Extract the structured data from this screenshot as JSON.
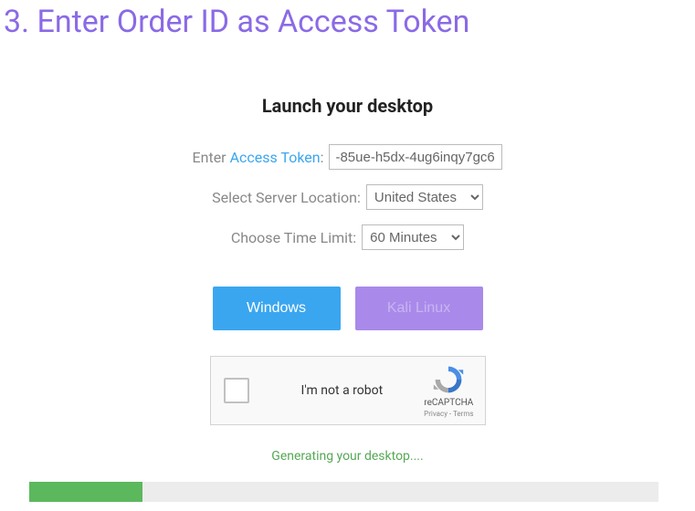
{
  "title": "3.  Enter Order ID as Access Token",
  "heading": "Launch your desktop",
  "form": {
    "token_label": "Enter ",
    "access_link_text": "Access Token",
    "token_label_suffix": ":",
    "token_value": "-85ue-h5dx-4ug6inqy7gc6",
    "server_label": "Select Server Location:",
    "server_selected": "United States",
    "time_label": "Choose Time Limit:",
    "time_selected": "60 Minutes"
  },
  "buttons": {
    "windows": "Windows",
    "kali": "Kali Linux"
  },
  "recaptcha": {
    "label": "I'm not a robot",
    "brand": "reCAPTCHA",
    "links": "Privacy - Terms"
  },
  "status": "Generating your desktop....",
  "progress_percent": 18
}
